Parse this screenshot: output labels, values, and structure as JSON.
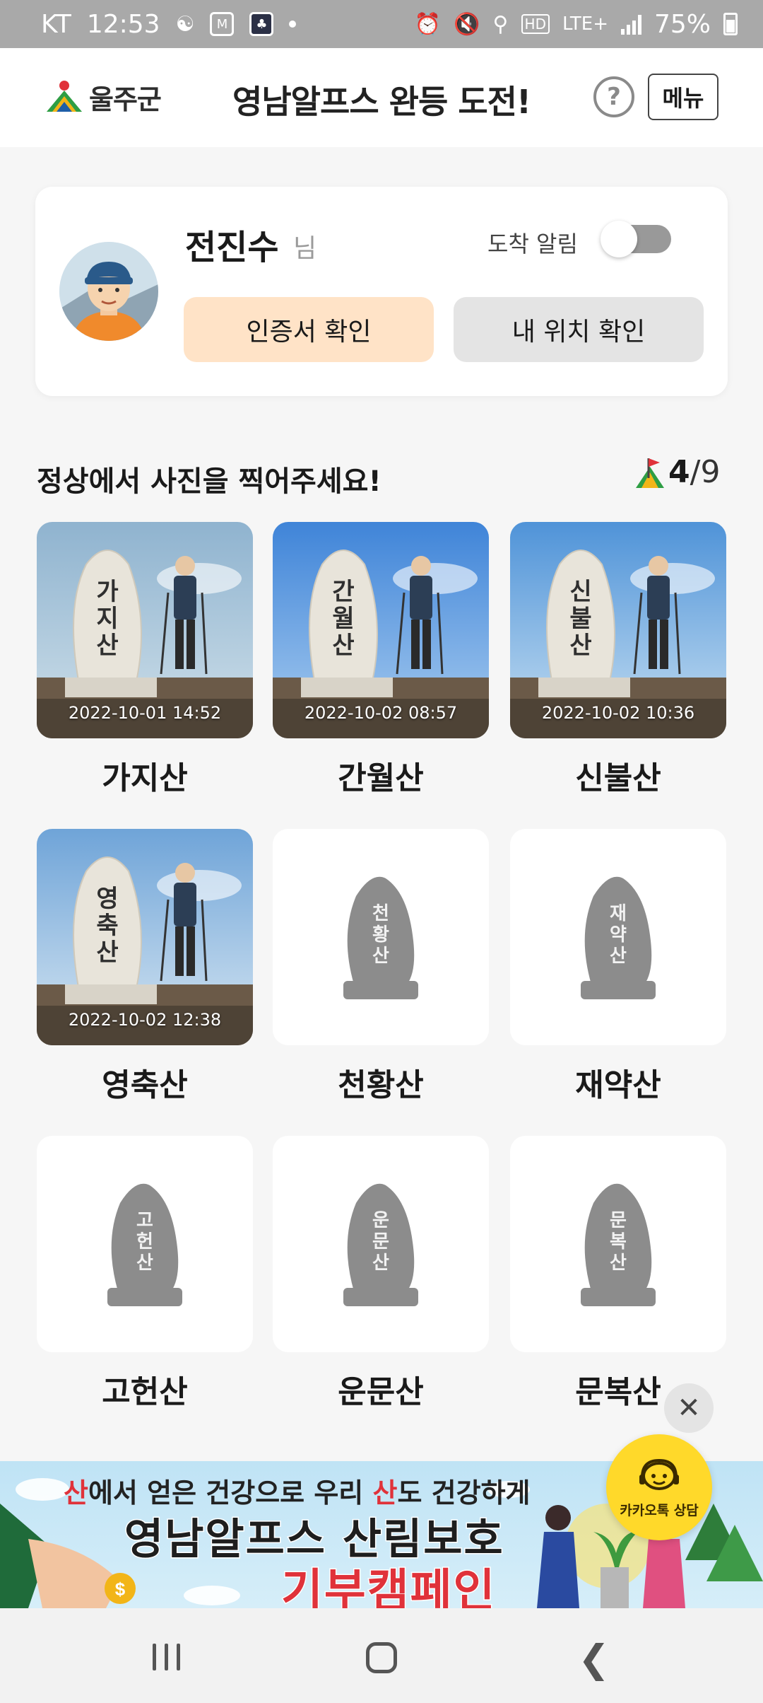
{
  "status_bar": {
    "carrier": "KT",
    "time": "12:53",
    "network": "LTE+",
    "battery": "75%"
  },
  "header": {
    "logo_text": "울주군",
    "title": "영남알프스 완등 도전!",
    "help_label": "?",
    "menu_label": "메뉴"
  },
  "profile": {
    "name": "전진수",
    "suffix": "님",
    "alarm_label": "도착 알림",
    "alarm_on": false,
    "cert_button": "인증서 확인",
    "location_button": "내 위치 확인"
  },
  "section": {
    "title": "정상에서 사진을 찍어주세요!",
    "completed": "4",
    "separator": "/",
    "total": "9"
  },
  "mountains": [
    {
      "name": "가지산",
      "date": "2022-10-01 14:52",
      "done": true,
      "stone": "가지산"
    },
    {
      "name": "간월산",
      "date": "2022-10-02 08:57",
      "done": true,
      "stone": "간월산"
    },
    {
      "name": "신불산",
      "date": "2022-10-02 10:36",
      "done": true,
      "stone": "신불산"
    },
    {
      "name": "영축산",
      "date": "2022-10-02 12:38",
      "done": true,
      "stone": "영축산"
    },
    {
      "name": "천황산",
      "date": "",
      "done": false,
      "stone": "천황산"
    },
    {
      "name": "재약산",
      "date": "",
      "done": false,
      "stone": "재약산"
    },
    {
      "name": "고헌산",
      "date": "",
      "done": false,
      "stone": "고헌산"
    },
    {
      "name": "운문산",
      "date": "",
      "done": false,
      "stone": "운문산"
    },
    {
      "name": "문복산",
      "date": "",
      "done": false,
      "stone": "문복산"
    }
  ],
  "banner": {
    "line1_a": "산",
    "line1_b": "에서 얻은 건강으로 우리 ",
    "line1_c": "산",
    "line1_d": "도 건강하게",
    "line2": "영남알프스 산림보호",
    "line3": "기부캠페인"
  },
  "kakao": {
    "label": "카카오톡 상담"
  },
  "colors": {
    "accent_orange": "#ffe3c7",
    "red": "#e0323a",
    "kakao_yellow": "#ffd92a"
  }
}
